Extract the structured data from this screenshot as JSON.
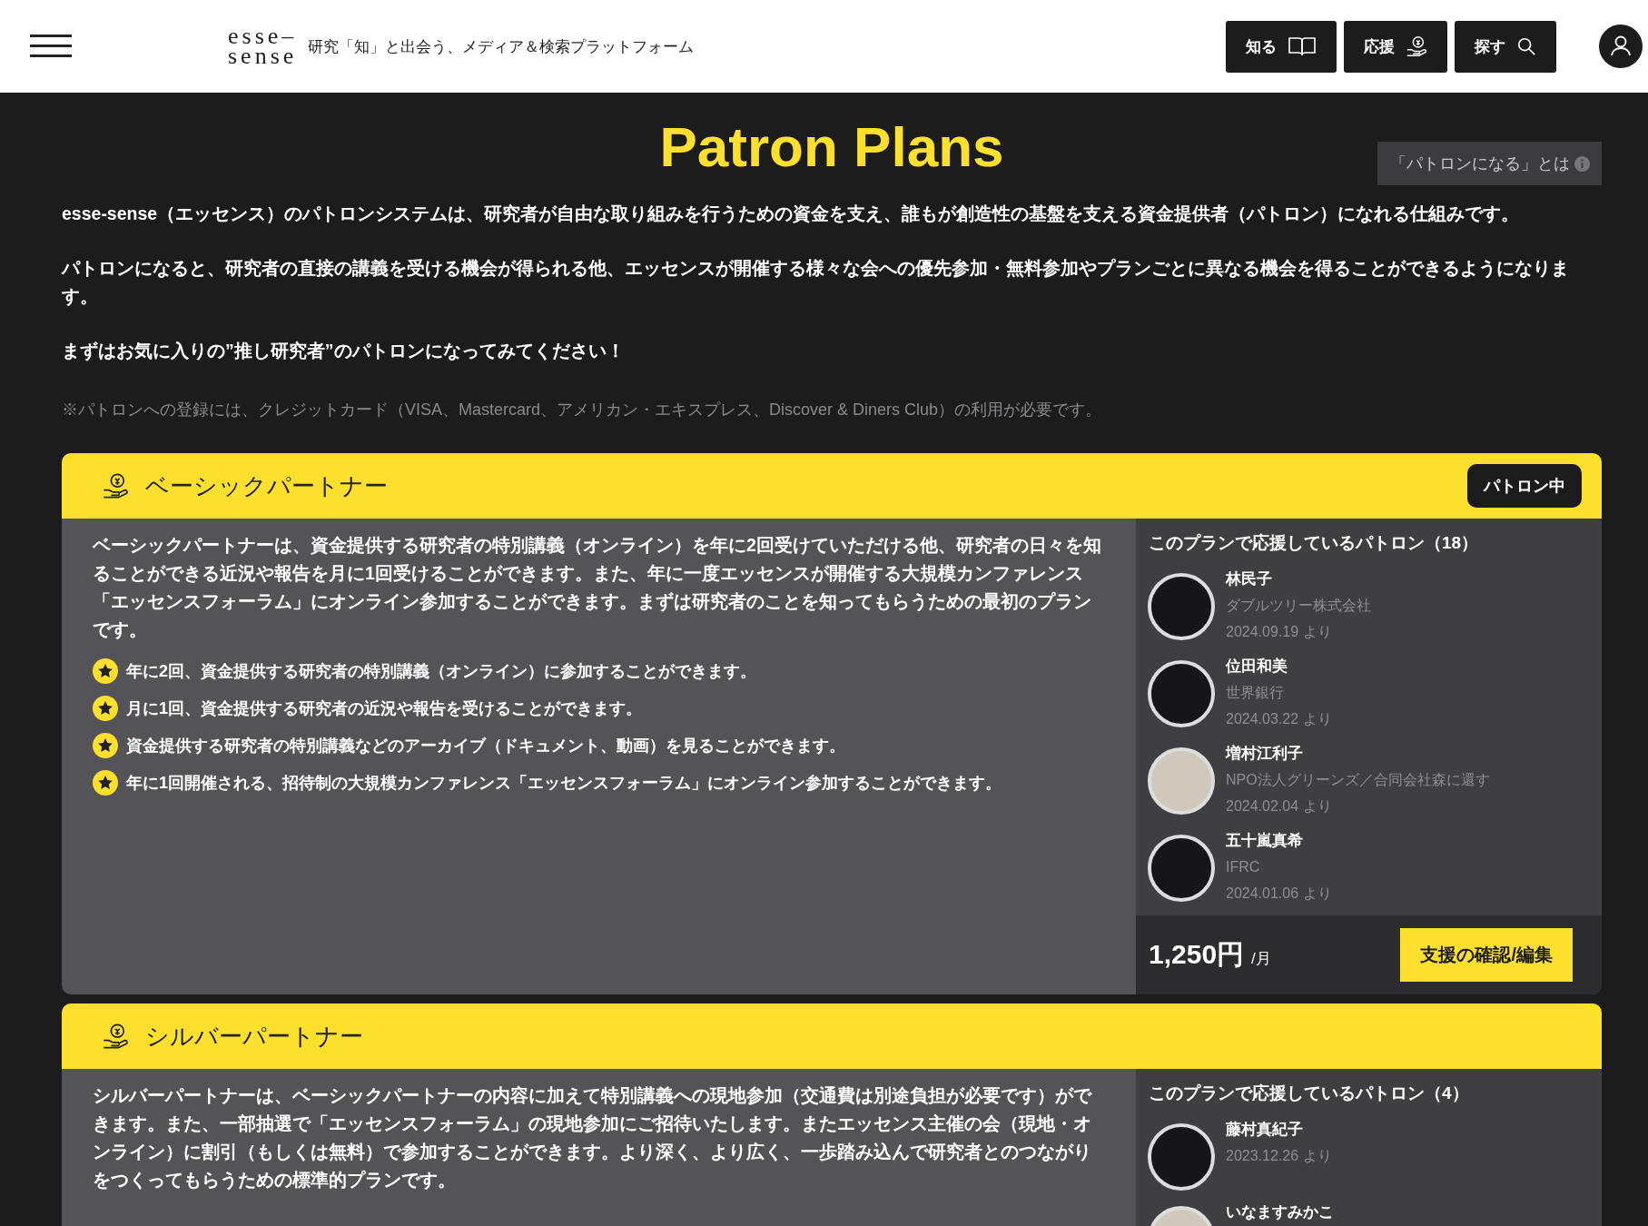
{
  "header": {
    "logo_lines": [
      "esse–",
      "sense"
    ],
    "tagline": "研究「知」と出会う、メディア＆検索プラットフォーム",
    "nav": [
      {
        "label": "知る",
        "kind": "book"
      },
      {
        "label": "応援",
        "kind": "hand-coin"
      },
      {
        "label": "探す",
        "kind": "search"
      }
    ]
  },
  "page": {
    "title": "Patron Plans",
    "info_button": "「パトロンになる」とは",
    "intro": [
      "esse-sense（エッセンス）のパトロンシステムは、研究者が自由な取り組みを行うための資金を支え、誰もが創造性の基盤を支える資金提供者（パトロン）になれる仕組みです。",
      "パトロンになると、研究者の直接の講義を受ける機会が得られる他、エッセンスが開催する様々な会への優先参加・無料参加やプランごとに異なる機会を得ることができるようになります。",
      "まずはお気に入りの”推し研究者”のパトロンになってみてください！"
    ],
    "note": "※パトロンへの登録には、クレジットカード（VISA、Mastercard、アメリカン・エキスプレス、Discover & Diners Club）の利用が必要です。"
  },
  "plans": [
    {
      "name": "ベーシックパートナー",
      "status": "パトロン中",
      "description": "ベーシックパートナーは、資金提供する研究者の特別講義（オンライン）を年に2回受けていただける他、研究者の日々を知ることができる近況や報告を月に1回受けることができます。また、年に一度エッセンスが開催する大規模カンファレンス「エッセンスフォーラム」にオンライン参加することができます。まずは研究者のことを知ってもらうための最初のプランです。",
      "benefits": [
        "年に2回、資金提供する研究者の特別講義（オンライン）に参加することができます。",
        "月に1回、資金提供する研究者の近況や報告を受けることができます。",
        "資金提供する研究者の特別講義などのアーカイブ（ドキュメント、動画）を見ることができます。",
        "年に1回開催される、招待制の大規模カンファレンス「エッセンスフォーラム」にオンライン参加することができます。"
      ],
      "supporters_heading": "このプランで応援しているパトロン（18）",
      "supporters": [
        {
          "name": "林民子",
          "org": "ダブルツリー株式会社",
          "since": "2024.09.19 より",
          "kind": "blank"
        },
        {
          "name": "位田和美",
          "org": "世界銀行",
          "since": "2024.03.22 より",
          "kind": "blank"
        },
        {
          "name": "増村江利子",
          "org": "NPO法人グリーンズ／合同会社森に還す",
          "since": "2024.02.04 より",
          "kind": "photo"
        },
        {
          "name": "五十嵐真希",
          "org": "IFRC",
          "since": "2024.01.06 より",
          "kind": "blank"
        }
      ],
      "price": "1,250円",
      "price_unit": "/月",
      "action": "支援の確認/編集"
    },
    {
      "name": "シルバーパートナー",
      "description": "シルバーパートナーは、ベーシックパートナーの内容に加えて特別講義への現地参加（交通費は別途負担が必要です）ができます。また、一部抽選で「エッセンスフォーラム」の現地参加にご招待いたします。またエッセンス主催の会（現地・オンライン）に割引（もしくは無料）で参加することができます。より深く、より広く、一歩踏み込んで研究者とのつながりをつくってもらうための標準的プランです。",
      "supporters_heading": "このプランで応援しているパトロン（4）",
      "supporters": [
        {
          "name": "藤村真紀子",
          "since": "2023.12.26 より",
          "kind": "blank"
        },
        {
          "name": "いなますみかこ",
          "kind": "photo"
        }
      ]
    }
  ]
}
